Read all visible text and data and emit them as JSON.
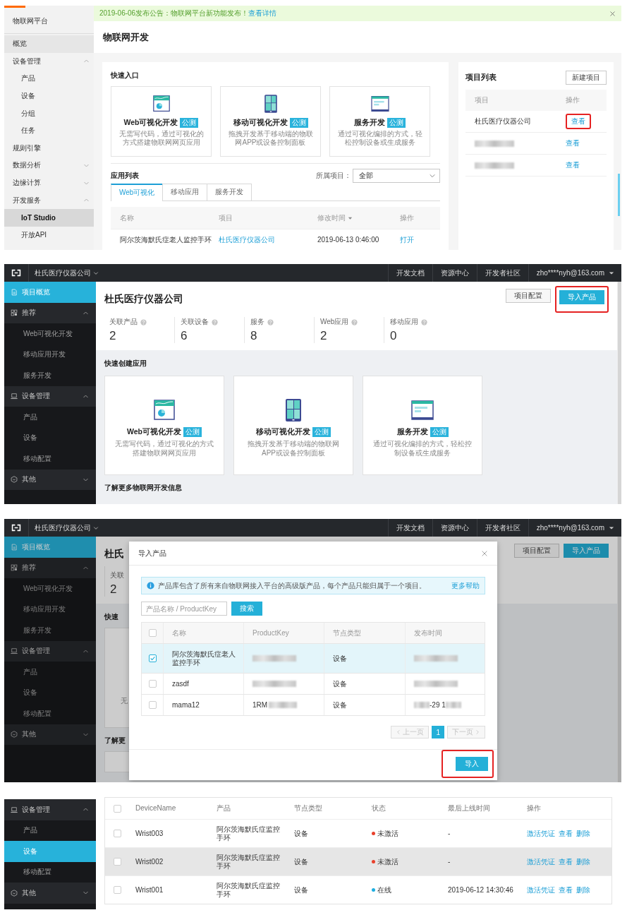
{
  "platform_page": {
    "sidebar": {
      "title": "物联网平台",
      "items": [
        {
          "label": "概览",
          "kind": "home",
          "selected": false
        },
        {
          "label": "设备管理",
          "kind": "group",
          "selected": false,
          "expanded": true,
          "children": [
            {
              "label": "产品",
              "selected": false
            },
            {
              "label": "设备",
              "selected": false
            },
            {
              "label": "分组",
              "selected": false
            },
            {
              "label": "任务",
              "selected": false
            }
          ]
        },
        {
          "label": "规则引擎",
          "kind": "link",
          "selected": false
        },
        {
          "label": "数据分析",
          "kind": "group",
          "selected": false,
          "expanded": false
        },
        {
          "label": "边缘计算",
          "kind": "group",
          "selected": false,
          "expanded": false
        },
        {
          "label": "开发服务",
          "kind": "group",
          "selected": false,
          "expanded": true,
          "children": [
            {
              "label": "IoT Studio",
              "selected": true
            },
            {
              "label": "开放API",
              "selected": false
            }
          ]
        }
      ]
    },
    "notice": {
      "text": "2019-06-06发布公告：物联网平台新功能发布！",
      "link": "查看详情"
    },
    "page_title": "物联网开发",
    "quick_entry": {
      "title": "快速入口",
      "cards": [
        {
          "kind": "web",
          "title": "Web可视化开发",
          "badge": "公测",
          "description": "无需写代码，通过可视化的方式搭建物联网网页应用"
        },
        {
          "kind": "mobile",
          "title": "移动可视化开发",
          "badge": "公测",
          "description": "拖拽开发基于移动端的物联网APP或设备控制面板"
        },
        {
          "kind": "service",
          "title": "服务开发",
          "badge": "公测",
          "description": "通过可视化编排的方式，轻松控制设备或生成服务"
        }
      ]
    },
    "app_list": {
      "title": "应用列表",
      "filter_label": "所属项目：",
      "filter_value": "全部",
      "tabs": [
        {
          "label": "Web可视化",
          "selected": true
        },
        {
          "label": "移动应用",
          "selected": false
        },
        {
          "label": "服务开发",
          "selected": false
        }
      ],
      "columns": [
        {
          "label": "名称",
          "sorted": false
        },
        {
          "label": "项目",
          "sorted": false
        },
        {
          "label": "修改时间",
          "sorted": true
        },
        {
          "label": "操作",
          "sorted": false
        }
      ],
      "rows": [
        {
          "name": "阿尔茨海默氏症老人监控手环",
          "project": "杜氏医疗仪器公司",
          "modified": "2019-06-13 0:46:00",
          "action": "打开"
        }
      ]
    },
    "project_list": {
      "title": "项目列表",
      "button": "新建项目",
      "columns": [
        "项目",
        "操作"
      ],
      "rows": [
        {
          "name": "杜氏医疗仪器公司",
          "blurred": false,
          "action": "查看",
          "highlighted": true
        },
        {
          "blurred": true,
          "action": "查看",
          "highlighted": false
        },
        {
          "blurred": true,
          "action": "查看",
          "highlighted": false
        }
      ]
    }
  },
  "project_overview": {
    "top_bar": {
      "project": "杜氏医疗仪器公司",
      "links": [
        "开发文档",
        "资源中心",
        "开发者社区"
      ],
      "user": "zho****nyh@163.com"
    },
    "sidebar": [
      {
        "label": "项目概览",
        "kind": "overview",
        "selected": true
      },
      {
        "label": "推荐",
        "kind": "recommend",
        "selected": false,
        "expanded": true,
        "children": [
          {
            "label": "Web可视化开发",
            "selected": false
          },
          {
            "label": "移动应用开发",
            "selected": false
          },
          {
            "label": "服务开发",
            "selected": false
          }
        ]
      },
      {
        "label": "设备管理",
        "kind": "devices",
        "selected": false,
        "expanded": true,
        "children": [
          {
            "label": "产品",
            "selected": false
          },
          {
            "label": "设备",
            "selected": false
          },
          {
            "label": "移动配置",
            "selected": false
          }
        ]
      },
      {
        "label": "其他",
        "kind": "other",
        "selected": false,
        "expanded": false
      }
    ],
    "title": "杜氏医疗仪器公司",
    "buttons": [
      {
        "label": "项目配置",
        "kind": "default",
        "highlighted": false
      },
      {
        "label": "导入产品",
        "kind": "primary",
        "highlighted": true
      }
    ],
    "stats": [
      {
        "label": "关联产品",
        "value": "2"
      },
      {
        "label": "关联设备",
        "value": "6"
      },
      {
        "label": "服务",
        "value": "8"
      },
      {
        "label": "Web应用",
        "value": "2"
      },
      {
        "label": "移动应用",
        "value": "0"
      }
    ],
    "quick_create": {
      "title": "快速创建应用",
      "cards": [
        {
          "kind": "web",
          "title": "Web可视化开发",
          "badge": "公测",
          "description": "无需写代码，通过可视化的方式搭建物联网网页应用"
        },
        {
          "kind": "mobile",
          "title": "移动可视化开发",
          "badge": "公测",
          "description": "拖拽开发基于移动端的物联网APP或设备控制面板"
        },
        {
          "kind": "service",
          "title": "服务开发",
          "badge": "公测",
          "description": "通过可视化编排的方式，轻松控制设备或生成服务"
        }
      ]
    },
    "more_info_title": "了解更多物联网开发信息"
  },
  "import_dialog_view": {
    "top_bar": {
      "project": "杜氏医疗仪器公司",
      "links": [
        "开发文档",
        "资源中心",
        "开发者社区"
      ],
      "user": "zho****nyh@163.com"
    },
    "sidebar": [
      {
        "label": "项目概览",
        "kind": "overview",
        "selected": true
      },
      {
        "label": "推荐",
        "kind": "recommend",
        "selected": false,
        "expanded": true,
        "children": [
          {
            "label": "Web可视化开发",
            "selected": false
          },
          {
            "label": "移动应用开发",
            "selected": false
          },
          {
            "label": "服务开发",
            "selected": false
          }
        ]
      },
      {
        "label": "设备管理",
        "kind": "devices",
        "selected": false,
        "expanded": true,
        "children": [
          {
            "label": "产品",
            "selected": false
          },
          {
            "label": "设备",
            "selected": false
          },
          {
            "label": "移动配置",
            "selected": false
          }
        ]
      },
      {
        "label": "其他",
        "kind": "other",
        "selected": false,
        "expanded": false
      }
    ],
    "background": {
      "title": "杜氏",
      "stat_label": "关联",
      "stat_value": "2",
      "section_title": "快速",
      "card_text": "无",
      "more_title": "了解更",
      "buttons": [
        {
          "label": "项目配置",
          "kind": "default"
        },
        {
          "label": "导入产品",
          "kind": "primary"
        }
      ]
    },
    "dialog": {
      "title": "导入产品",
      "notice": "产品库包含了所有来自物联网接入平台的高级版产品，每个产品只能归属于一个项目。",
      "help_link": "更多帮助",
      "search_placeholder": "产品名称 / ProductKey",
      "search_button": "搜索",
      "columns": [
        "名称",
        "ProductKey",
        "节点类型",
        "发布时间"
      ],
      "all_checked": false,
      "rows": [
        {
          "checked": true,
          "selected": true,
          "name": "阿尔茨海默氏症老人监控手环",
          "node_type": "设备"
        },
        {
          "checked": false,
          "selected": false,
          "name": "zasdf",
          "node_type": "设备"
        },
        {
          "checked": false,
          "selected": false,
          "name": "mama12",
          "product_key": "1RM",
          "node_type": "设备",
          "published": "-29 1"
        }
      ],
      "pagination": {
        "prev": "上一页",
        "prev_disabled": true,
        "pages": [
          {
            "label": "1",
            "selected": true
          }
        ],
        "next": "下一页",
        "next_disabled": true
      },
      "confirm_button": "导入",
      "confirm_highlighted": true
    }
  },
  "device_list_view": {
    "sidebar": [
      {
        "label": "设备管理",
        "kind": "devices",
        "selected": false,
        "expanded": true,
        "children": [
          {
            "label": "产品",
            "selected": false
          },
          {
            "label": "设备",
            "selected": true
          },
          {
            "label": "移动配置",
            "selected": false
          }
        ]
      },
      {
        "label": "其他",
        "kind": "other",
        "selected": false,
        "expanded": false
      }
    ],
    "table": {
      "columns": [
        "DeviceName",
        "产品",
        "节点类型",
        "状态",
        "最后上线时间",
        "操作"
      ],
      "all_checked": false,
      "rows": [
        {
          "checked": false,
          "hovered": false,
          "device": "Wrist003",
          "product": "阿尔茨海默氏症监控手环",
          "node_type": "设备",
          "status": {
            "label": "未激活",
            "color": "#e8412c"
          },
          "last_online": "-",
          "actions": [
            "激活凭证",
            "查看",
            "删除"
          ]
        },
        {
          "checked": false,
          "hovered": true,
          "device": "Wrist002",
          "product": "阿尔茨海默氏症监控手环",
          "node_type": "设备",
          "status": {
            "label": "未激活",
            "color": "#e8412c"
          },
          "last_online": "-",
          "actions": [
            "激活凭证",
            "查看",
            "删除"
          ]
        },
        {
          "checked": false,
          "hovered": false,
          "device": "Wrist001",
          "product": "阿尔茨海默氏症监控手环",
          "node_type": "设备",
          "status": {
            "label": "在线",
            "color": "#1eaee0"
          },
          "last_online": "2019-06-12 14:30:46",
          "actions": [
            "激活凭证",
            "查看",
            "删除"
          ]
        }
      ]
    }
  }
}
